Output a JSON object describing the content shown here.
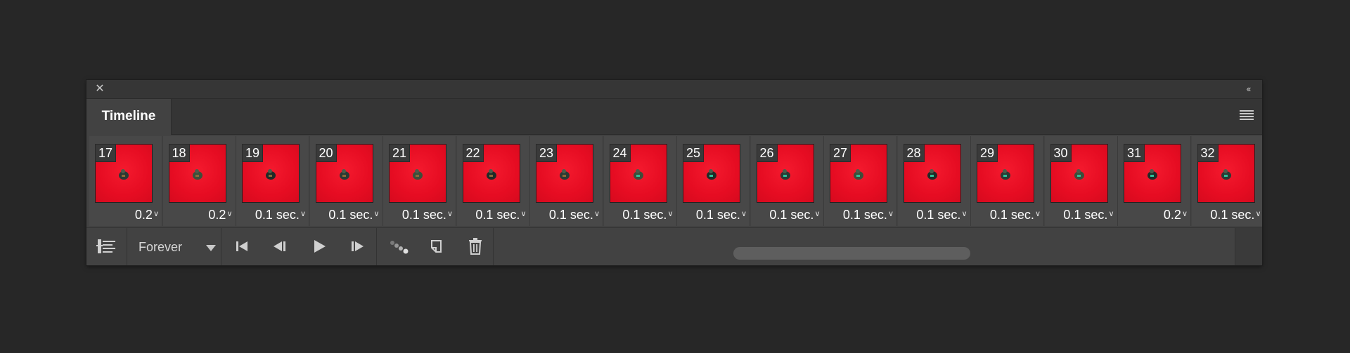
{
  "panel": {
    "close_glyph": "✕",
    "collapse_glyph": "‹‹",
    "tab_label": "Timeline",
    "menu_icon": "hamburger-menu-icon"
  },
  "frames": [
    {
      "number": "17",
      "delay": "0.2"
    },
    {
      "number": "18",
      "delay": "0.2"
    },
    {
      "number": "19",
      "delay": "0.1 sec."
    },
    {
      "number": "20",
      "delay": "0.1 sec."
    },
    {
      "number": "21",
      "delay": "0.1 sec."
    },
    {
      "number": "22",
      "delay": "0.1 sec."
    },
    {
      "number": "23",
      "delay": "0.1 sec."
    },
    {
      "number": "24",
      "delay": "0.1 sec."
    },
    {
      "number": "25",
      "delay": "0.1 sec."
    },
    {
      "number": "26",
      "delay": "0.1 sec."
    },
    {
      "number": "27",
      "delay": "0.1 sec."
    },
    {
      "number": "28",
      "delay": "0.1 sec."
    },
    {
      "number": "29",
      "delay": "0.1 sec."
    },
    {
      "number": "30",
      "delay": "0.1 sec."
    },
    {
      "number": "31",
      "delay": "0.2"
    },
    {
      "number": "32",
      "delay": "0.1 sec."
    }
  ],
  "frame_thumb_color": "#e60c22",
  "toolbar": {
    "loop_value": "Forever",
    "icons": [
      "convert-to-video-timeline-icon",
      "first-frame-icon",
      "previous-frame-icon",
      "play-icon",
      "next-frame-icon",
      "tween-icon",
      "duplicate-frame-icon",
      "delete-frame-icon"
    ]
  }
}
